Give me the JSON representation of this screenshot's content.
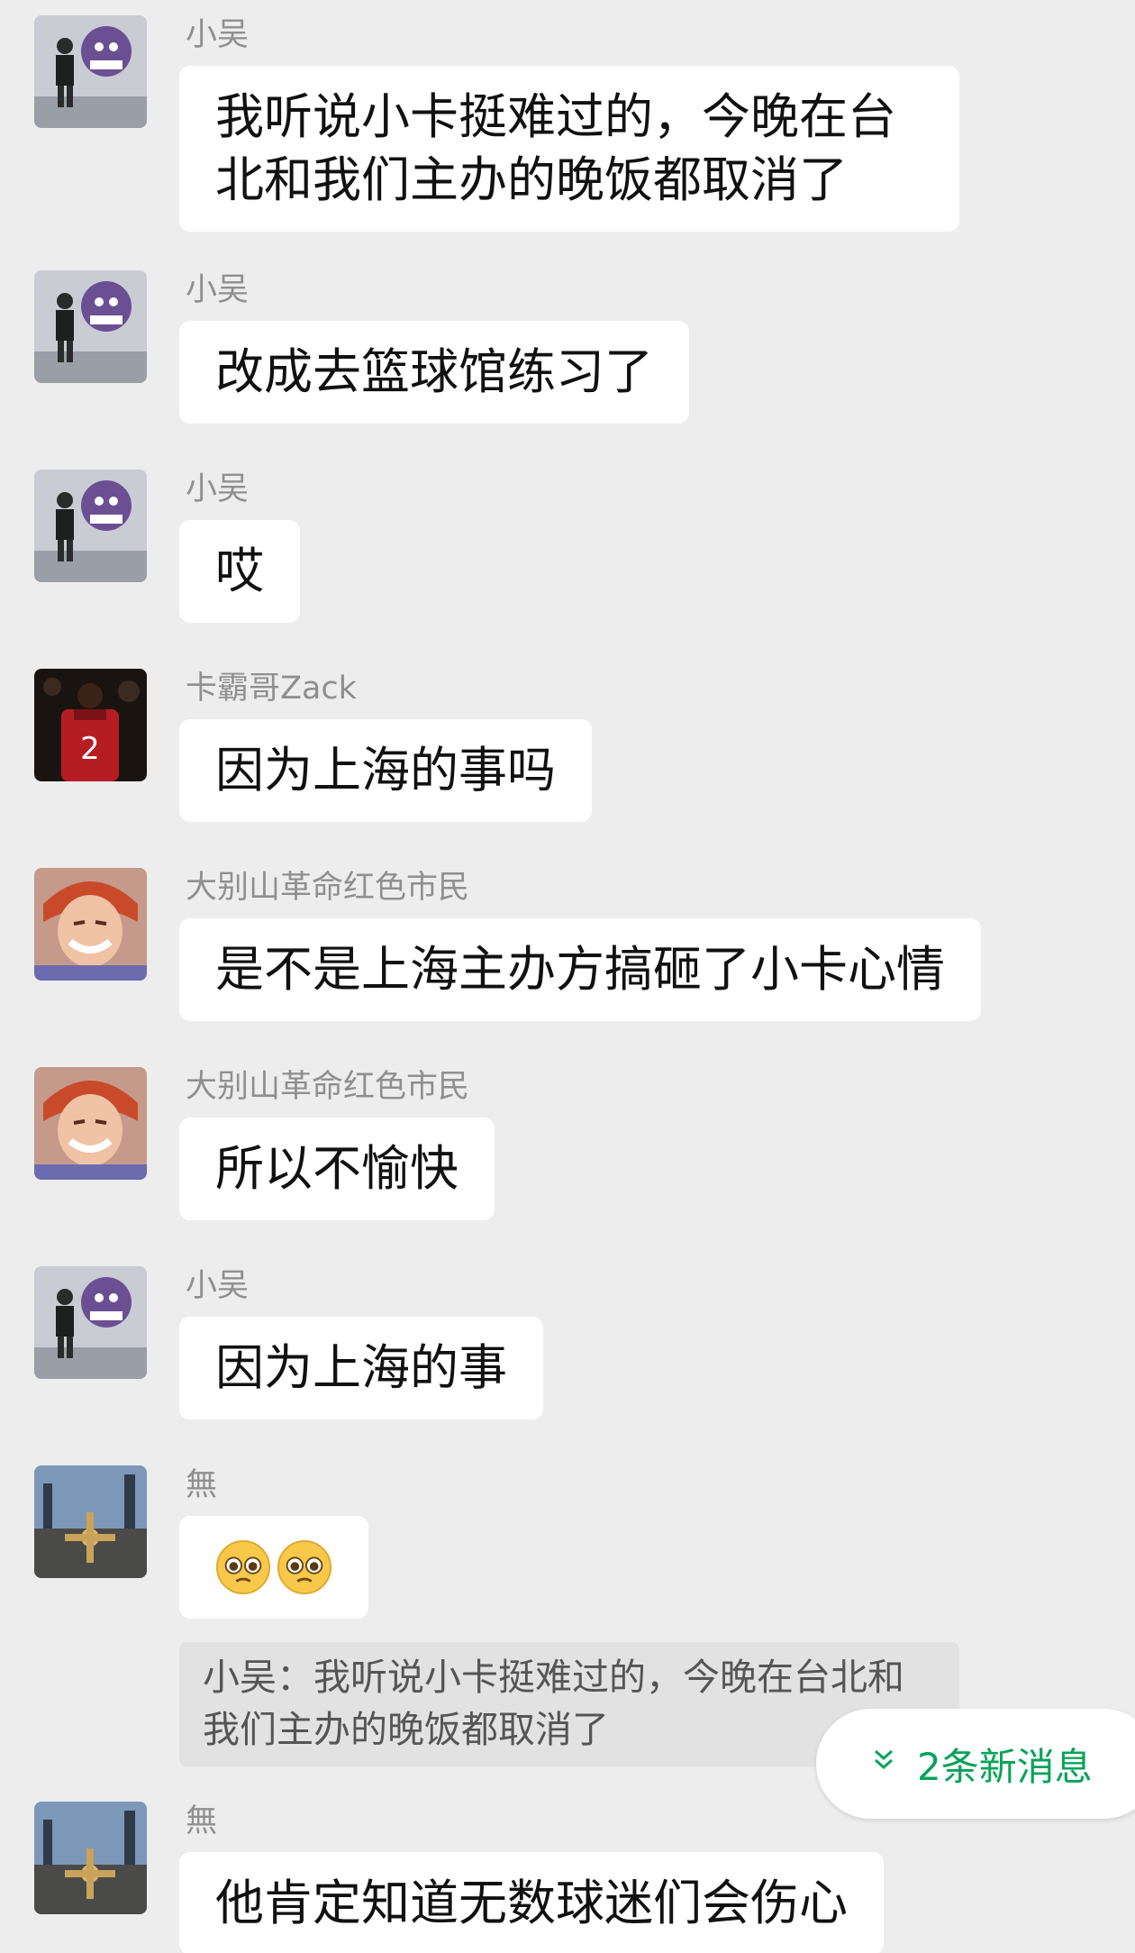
{
  "colors": {
    "background": "#ededed",
    "bubble": "#ffffff",
    "sender_name": "#8f8f8f",
    "new_messages": "#07a35a",
    "quote_bg": "#e2e2e2"
  },
  "messages": [
    {
      "sender": "小吴",
      "avatar": "figure-avatar",
      "text": "我听说小卡挺难过的，今晚在台北和我们主办的晚饭都取消了"
    },
    {
      "sender": "小吴",
      "avatar": "figure-avatar",
      "text": "改成去篮球馆练习了"
    },
    {
      "sender": "小吴",
      "avatar": "figure-avatar",
      "text": "哎"
    },
    {
      "sender": "卡霸哥Zack",
      "avatar": "basketball-player-avatar",
      "text": "因为上海的事吗"
    },
    {
      "sender": "大别山革命红色市民",
      "avatar": "anime-character-avatar",
      "text": "是不是上海主办方搞砸了小卡心情"
    },
    {
      "sender": "大别山革命红色市民",
      "avatar": "anime-character-avatar",
      "text": "所以不愉快"
    },
    {
      "sender": "小吴",
      "avatar": "figure-avatar",
      "text": "因为上海的事"
    },
    {
      "sender": "無",
      "avatar": "landscape-avatar",
      "emojis": [
        "pleading-face-emoji",
        "pleading-face-emoji"
      ]
    },
    {
      "sender": "無",
      "avatar": "landscape-avatar",
      "text": "他肯定知道无数球迷们会伤心"
    }
  ],
  "quote": {
    "text": "小吴：我听说小卡挺难过的，今晚在台北和我们主办的晚饭都取消了"
  },
  "new_messages": {
    "icon": "double-chevron-down-icon",
    "label": "2条新消息"
  }
}
